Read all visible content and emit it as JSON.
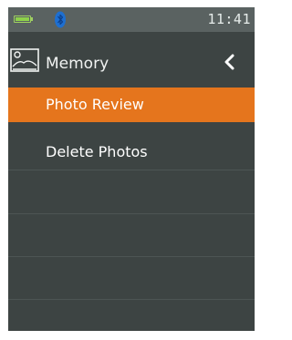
{
  "status_bar": {
    "time": "11:41",
    "battery_icon": "battery-icon",
    "bluetooth_icon": "bluetooth-icon",
    "colors": {
      "battery": "#8ed24a",
      "bluetooth": "#1e6fd0"
    }
  },
  "header": {
    "title": "Memory",
    "icon": "image-icon",
    "back_icon": "chevron-left-icon"
  },
  "menu": {
    "items": [
      {
        "label": "Photo Review",
        "selected": true
      },
      {
        "label": "Delete Photos",
        "selected": false
      }
    ]
  },
  "colors": {
    "background": "#3d4443",
    "status_bar": "#5a6261",
    "selected_item": "#e5751d",
    "text": "#ffffff"
  }
}
